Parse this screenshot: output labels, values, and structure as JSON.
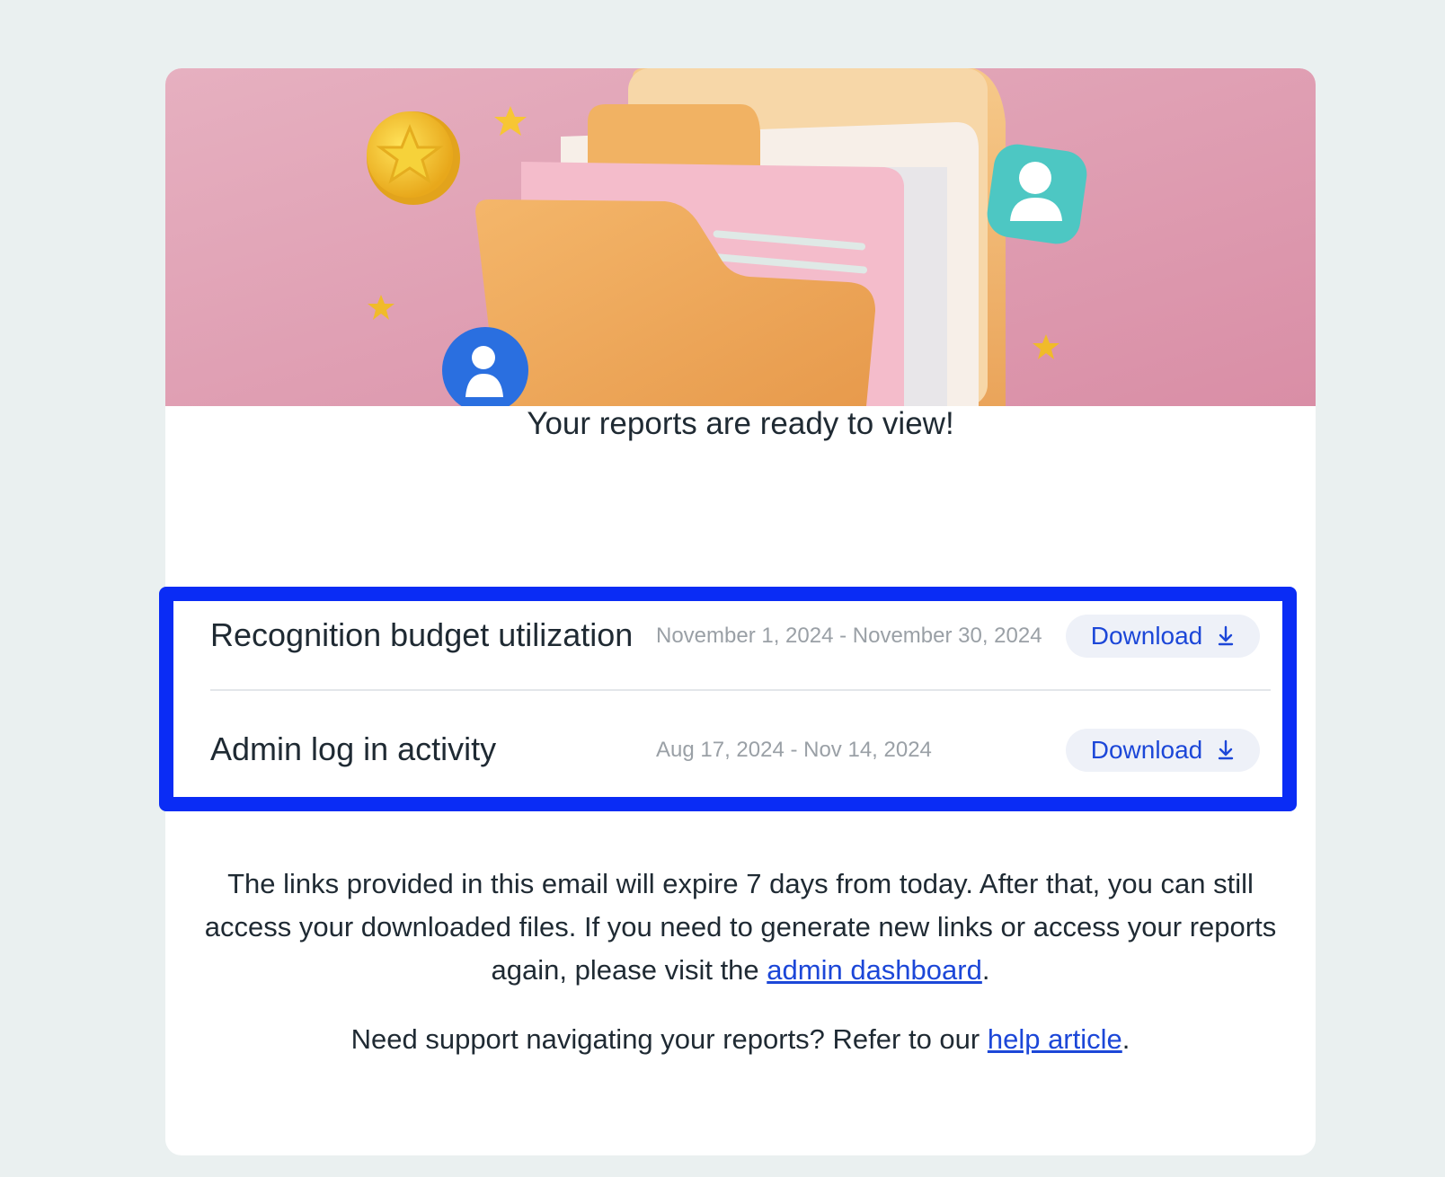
{
  "hero": {
    "image_name": "folder-illustration",
    "background_color": "#dea0b4"
  },
  "heading": "Your reports are ready to view!",
  "reports": [
    {
      "name": "Recognition budget utilization",
      "date_range": "November 1, 2024 - November 30, 2024",
      "action_label": "Download",
      "action_icon": "download-icon"
    },
    {
      "name": "Admin log in activity",
      "date_range": "Aug 17, 2024 - Nov 14, 2024",
      "action_label": "Download",
      "action_icon": "download-icon"
    }
  ],
  "footer": {
    "expiry_text": "The links provided in this email will expire 7 days from today. After that, you can still access your downloaded files. If you need to generate new links or access your reports again, please visit the ",
    "dashboard_link": "admin dashboard",
    "expiry_end": ".",
    "support_text": "Need support navigating your reports? Refer to our ",
    "help_link": "help article",
    "support_end": "."
  },
  "colors": {
    "highlight_border": "#0a2cf5",
    "link": "#1c47d8",
    "page_background": "#eaf0f0"
  }
}
